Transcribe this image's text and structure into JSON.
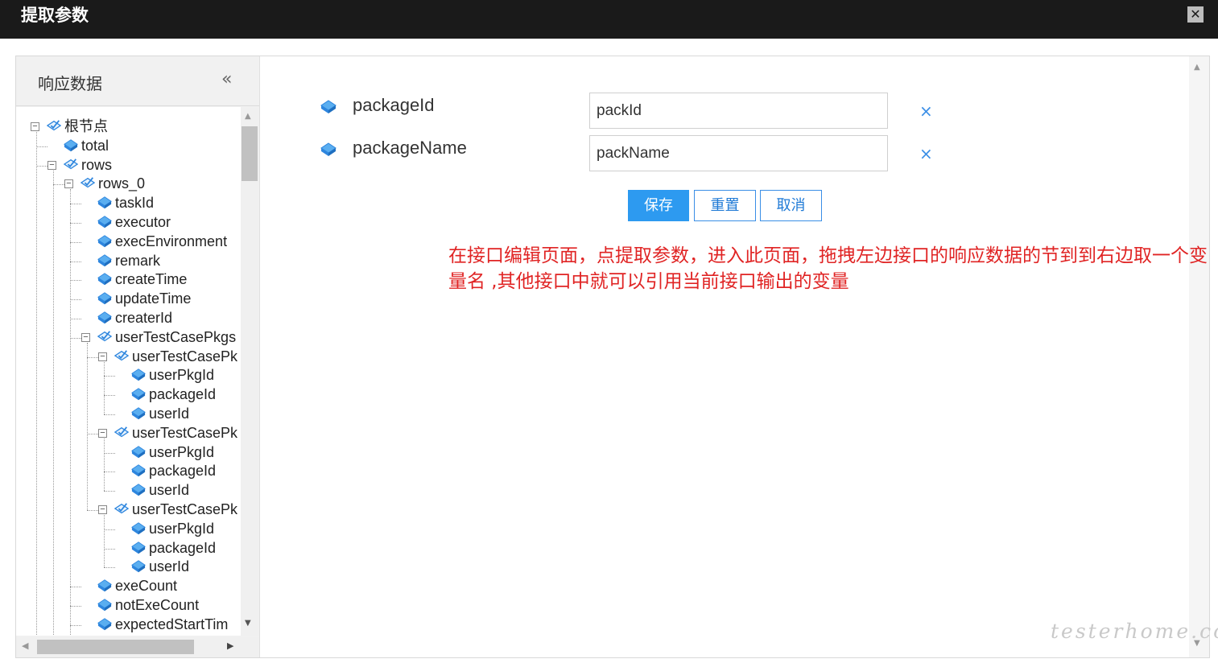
{
  "dialog": {
    "title": "提取参数",
    "close_label": "✕"
  },
  "left_panel": {
    "title": "响应数据",
    "collapse_label": "«",
    "tree": [
      {
        "label": "根节点",
        "folder": true
      },
      {
        "label": "total",
        "folder": false
      },
      {
        "label": "rows",
        "folder": true
      },
      {
        "label": "rows_0",
        "folder": true
      },
      {
        "label": "taskId",
        "folder": false
      },
      {
        "label": "executor",
        "folder": false
      },
      {
        "label": "execEnvironment",
        "folder": false
      },
      {
        "label": "remark",
        "folder": false
      },
      {
        "label": "createTime",
        "folder": false
      },
      {
        "label": "updateTime",
        "folder": false
      },
      {
        "label": "createrId",
        "folder": false
      },
      {
        "label": "userTestCasePkgs",
        "folder": true
      },
      {
        "label": "userTestCasePk",
        "folder": true
      },
      {
        "label": "userPkgId",
        "folder": false
      },
      {
        "label": "packageId",
        "folder": false
      },
      {
        "label": "userId",
        "folder": false
      },
      {
        "label": "userTestCasePk",
        "folder": true
      },
      {
        "label": "userPkgId",
        "folder": false
      },
      {
        "label": "packageId",
        "folder": false
      },
      {
        "label": "userId",
        "folder": false
      },
      {
        "label": "userTestCasePk",
        "folder": true
      },
      {
        "label": "userPkgId",
        "folder": false
      },
      {
        "label": "packageId",
        "folder": false
      },
      {
        "label": "userId",
        "folder": false
      },
      {
        "label": "exeCount",
        "folder": false
      },
      {
        "label": "notExeCount",
        "folder": false
      },
      {
        "label": "expectedStartTim",
        "folder": false
      }
    ]
  },
  "params": [
    {
      "name": "packageId",
      "value": "packId",
      "delete_label": "×"
    },
    {
      "name": "packageName",
      "value": "packName",
      "delete_label": "×"
    }
  ],
  "buttons": {
    "save": "保存",
    "reset": "重置",
    "cancel": "取消"
  },
  "note": "在接口编辑页面，点提取参数，进入此页面，拖拽左边接口的响应数据的节到到右边取一个变量名 ,其他接口中就可以引用当前接口输出的变量",
  "watermark": "testerhome.com",
  "colors": {
    "title_bar": "#1a1a1a",
    "primary": "#2d9af0",
    "note": "#e02424",
    "icon": "#2e86de"
  }
}
